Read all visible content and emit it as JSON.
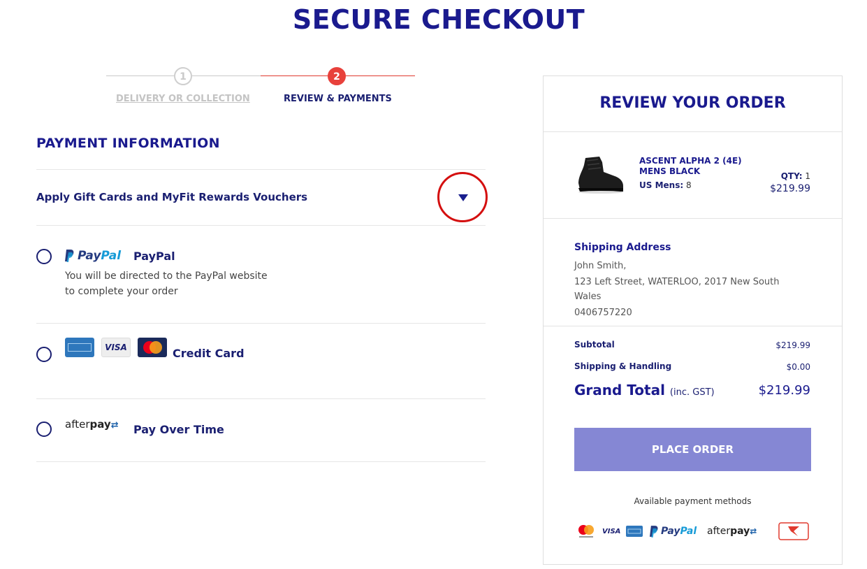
{
  "page": {
    "title": "SECURE CHECKOUT"
  },
  "stepper": {
    "steps": [
      {
        "number": "1",
        "label": "DELIVERY OR COLLECTION",
        "state": "completed-link"
      },
      {
        "number": "2",
        "label": "REVIEW & PAYMENTS",
        "state": "active"
      }
    ]
  },
  "payment": {
    "section_title": "PAYMENT INFORMATION",
    "gift_cards_label": "Apply Gift Cards and MyFit Rewards Vouchers",
    "options": [
      {
        "id": "paypal",
        "logo_text_1": "Pay",
        "logo_text_2": "Pal",
        "name": "PayPal",
        "description": "You will be directed to the PayPal website to complete your order",
        "selected": false
      },
      {
        "id": "credit-card",
        "name": "Credit Card",
        "card_logos": [
          "amex-icon",
          "visa-icon",
          "mastercard-icon"
        ],
        "visa_text": "VISA",
        "selected": false
      },
      {
        "id": "afterpay",
        "logo_text_light": "after",
        "logo_text_bold": "pay",
        "logo_arrows": "⇄",
        "name": "Pay Over Time",
        "selected": false
      }
    ]
  },
  "review": {
    "title": "REVIEW YOUR ORDER",
    "item": {
      "name": "ASCENT ALPHA 2 (4E) MENS BLACK",
      "size_label": "US Mens:",
      "size_value": "8",
      "qty_label": "QTY:",
      "qty_value": "1",
      "price": "$219.99"
    },
    "shipping": {
      "title": "Shipping Address",
      "name": "John Smith,",
      "address_line1": "123 Left Street, WATERLOO, 2017 New South",
      "address_line2": "Wales",
      "phone": "0406757220"
    },
    "totals": {
      "subtotal_label": "Subtotal",
      "subtotal_value": "$219.99",
      "shipping_label": "Shipping & Handling",
      "shipping_value": "$0.00",
      "grand_label": "Grand Total",
      "grand_suffix": "(inc. GST)",
      "grand_value": "$219.99"
    },
    "place_order_label": "PLACE ORDER",
    "available_methods_label": "Available payment methods",
    "methods": {
      "visa_text": "VISA",
      "paypal_pay": "Pay",
      "paypal_pal": "Pal",
      "afterpay_light": "after",
      "afterpay_bold": "pay",
      "afterpay_arrows": "⇄"
    }
  },
  "colors": {
    "brand_navy": "#1a1a8e",
    "accent_red": "#e8413b",
    "place_order_bg": "#8587d4",
    "highlight_circle": "#d40f0f"
  }
}
